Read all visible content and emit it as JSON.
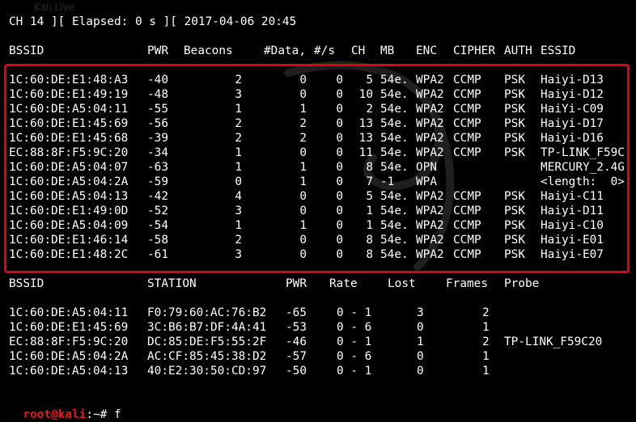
{
  "watermark": "Kali Live",
  "header": {
    "status_line": "CH 14 ][ Elapsed: 0 s ][ 2017-04-06 20:45"
  },
  "ap_table": {
    "headers": [
      "BSSID",
      "PWR",
      "Beacons",
      "#Data,",
      "#/s",
      "CH",
      "MB",
      "ENC",
      "CIPHER",
      "AUTH",
      "ESSID"
    ],
    "rows": [
      [
        "1C:60:DE:E1:48:A3",
        "-40",
        "2",
        "0",
        "0",
        "5",
        "54e.",
        "WPA2",
        "CCMP",
        "PSK",
        "Haiyi-D13"
      ],
      [
        "1C:60:DE:E1:49:19",
        "-48",
        "3",
        "0",
        "0",
        "10",
        "54e.",
        "WPA2",
        "CCMP",
        "PSK",
        "Haiyi-D12"
      ],
      [
        "1C:60:DE:A5:04:11",
        "-55",
        "1",
        "1",
        "0",
        "2",
        "54e.",
        "WPA2",
        "CCMP",
        "PSK",
        "HaiYi-C09"
      ],
      [
        "1C:60:DE:E1:45:69",
        "-56",
        "2",
        "2",
        "0",
        "13",
        "54e.",
        "WPA2",
        "CCMP",
        "PSK",
        "Haiyi-D17"
      ],
      [
        "1C:60:DE:E1:45:68",
        "-39",
        "2",
        "2",
        "0",
        "13",
        "54e.",
        "WPA2",
        "CCMP",
        "PSK",
        "Haiyi-D16"
      ],
      [
        "EC:88:8F:F5:9C:20",
        "-34",
        "1",
        "0",
        "0",
        "11",
        "54e.",
        "WPA2",
        "CCMP",
        "PSK",
        "TP-LINK_F59C"
      ],
      [
        "1C:60:DE:A5:04:07",
        "-63",
        "1",
        "1",
        "0",
        "8",
        "54e.",
        "OPN",
        "",
        "",
        "MERCURY_2.4G"
      ],
      [
        "1C:60:DE:A5:04:2A",
        "-59",
        "0",
        "1",
        "0",
        "7",
        "-1",
        "WPA",
        "",
        "",
        "<length:  0>"
      ],
      [
        "1C:60:DE:A5:04:13",
        "-42",
        "4",
        "0",
        "0",
        "5",
        "54e.",
        "WPA2",
        "CCMP",
        "PSK",
        "Haiyi-C11"
      ],
      [
        "1C:60:DE:E1:49:0D",
        "-52",
        "3",
        "0",
        "0",
        "1",
        "54e.",
        "WPA2",
        "CCMP",
        "PSK",
        "Haiyi-D11"
      ],
      [
        "1C:60:DE:A5:04:09",
        "-54",
        "1",
        "1",
        "0",
        "1",
        "54e.",
        "WPA2",
        "CCMP",
        "PSK",
        "Haiyi-C10"
      ],
      [
        "1C:60:DE:E1:46:14",
        "-58",
        "2",
        "0",
        "0",
        "8",
        "54e.",
        "WPA2",
        "CCMP",
        "PSK",
        "Haiyi-E01"
      ],
      [
        "1C:60:DE:E1:48:2C",
        "-61",
        "3",
        "0",
        "0",
        "8",
        "54e.",
        "WPA2",
        "CCMP",
        "PSK",
        "Haiyi-E07"
      ]
    ]
  },
  "station_table": {
    "headers": [
      "BSSID",
      "STATION",
      "PWR",
      "Rate",
      "Lost",
      "Frames",
      "Probe"
    ],
    "rows": [
      [
        "1C:60:DE:A5:04:11",
        "F0:79:60:AC:76:B2",
        "-65",
        "0 - 1",
        "3",
        "2",
        ""
      ],
      [
        "1C:60:DE:E1:45:69",
        "3C:B6:B7:DF:4A:41",
        "-53",
        "0 - 6",
        "0",
        "1",
        ""
      ],
      [
        "EC:88:8F:F5:9C:20",
        "DC:85:DE:F5:55:2F",
        "-46",
        "0 - 1",
        "1",
        "2",
        "TP-LINK_F59C20"
      ],
      [
        "1C:60:DE:A5:04:2A",
        "AC:CF:85:45:38:D2",
        "-57",
        "0 - 6",
        "0",
        "1",
        ""
      ],
      [
        "1C:60:DE:A5:04:13",
        "40:E2:30:50:CD:97",
        "-50",
        "0 - 1",
        "0",
        "1",
        ""
      ]
    ]
  },
  "prompt": {
    "user_host": "root@kali",
    "path_sep": ":~# ",
    "command": "f"
  },
  "colors": {
    "highlight_box": "#e0001b",
    "prompt": "#e3191b",
    "background": "#000000",
    "text": "#ffffff"
  }
}
